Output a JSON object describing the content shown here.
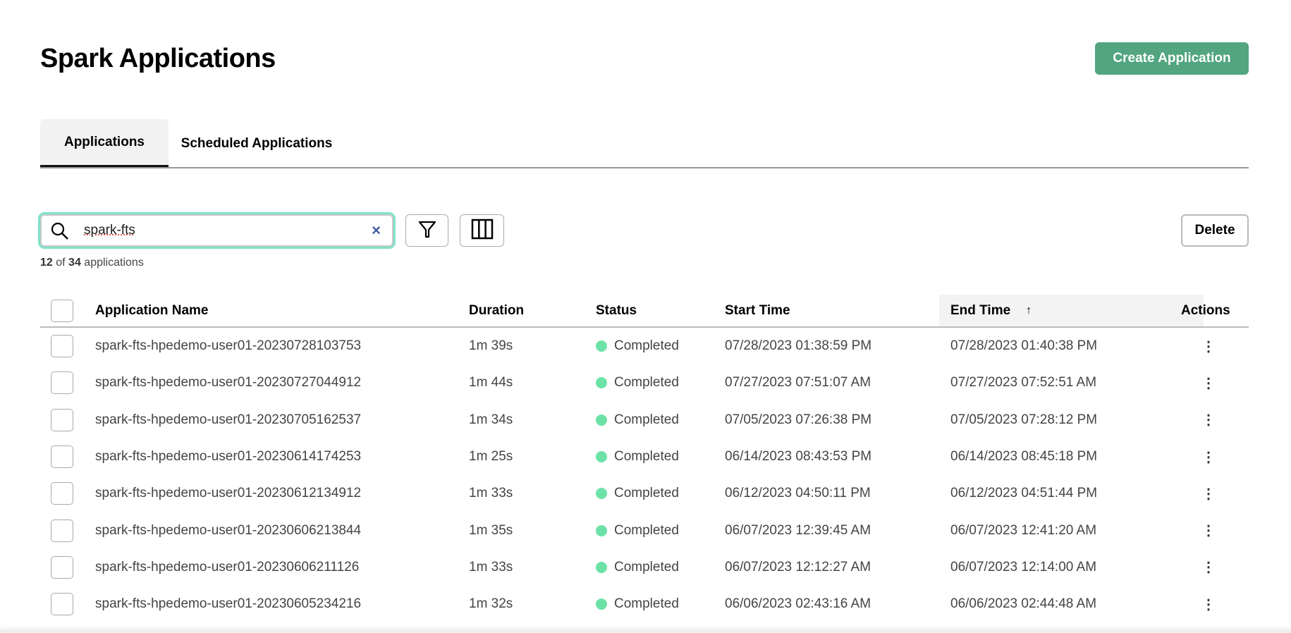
{
  "header": {
    "title": "Spark Applications",
    "create_label": "Create Application"
  },
  "tabs": [
    {
      "label": "Applications",
      "active": true
    },
    {
      "label": "Scheduled Applications",
      "active": false
    }
  ],
  "toolbar": {
    "search_value": "spark-fts",
    "clear_label": "×",
    "delete_label": "Delete"
  },
  "count": {
    "shown": "12",
    "of_label": "of",
    "total": "34",
    "suffix": "applications"
  },
  "table": {
    "headers": {
      "name": "Application Name",
      "duration": "Duration",
      "status": "Status",
      "start": "Start Time",
      "end": "End Time",
      "sort_indicator": "↑",
      "actions": "Actions"
    },
    "rows": [
      {
        "name": "spark-fts-hpedemo-user01-20230728103753",
        "duration": "1m 39s",
        "status": "Completed",
        "start": "07/28/2023 01:38:59 PM",
        "end": "07/28/2023 01:40:38 PM"
      },
      {
        "name": "spark-fts-hpedemo-user01-20230727044912",
        "duration": "1m 44s",
        "status": "Completed",
        "start": "07/27/2023 07:51:07 AM",
        "end": "07/27/2023 07:52:51 AM"
      },
      {
        "name": "spark-fts-hpedemo-user01-20230705162537",
        "duration": "1m 34s",
        "status": "Completed",
        "start": "07/05/2023 07:26:38 PM",
        "end": "07/05/2023 07:28:12 PM"
      },
      {
        "name": "spark-fts-hpedemo-user01-20230614174253",
        "duration": "1m 25s",
        "status": "Completed",
        "start": "06/14/2023 08:43:53 PM",
        "end": "06/14/2023 08:45:18 PM"
      },
      {
        "name": "spark-fts-hpedemo-user01-20230612134912",
        "duration": "1m 33s",
        "status": "Completed",
        "start": "06/12/2023 04:50:11 PM",
        "end": "06/12/2023 04:51:44 PM"
      },
      {
        "name": "spark-fts-hpedemo-user01-20230606213844",
        "duration": "1m 35s",
        "status": "Completed",
        "start": "06/07/2023 12:39:45 AM",
        "end": "06/07/2023 12:41:20 AM"
      },
      {
        "name": "spark-fts-hpedemo-user01-20230606211126",
        "duration": "1m 33s",
        "status": "Completed",
        "start": "06/07/2023 12:12:27 AM",
        "end": "06/07/2023 12:14:00 AM"
      },
      {
        "name": "spark-fts-hpedemo-user01-20230605234216",
        "duration": "1m 32s",
        "status": "Completed",
        "start": "06/06/2023 02:43:16 AM",
        "end": "06/06/2023 02:44:48 AM"
      }
    ]
  },
  "colors": {
    "accent": "#52a57f",
    "status_completed": "#6de2a7",
    "focus_ring": "#7fe3c9"
  }
}
